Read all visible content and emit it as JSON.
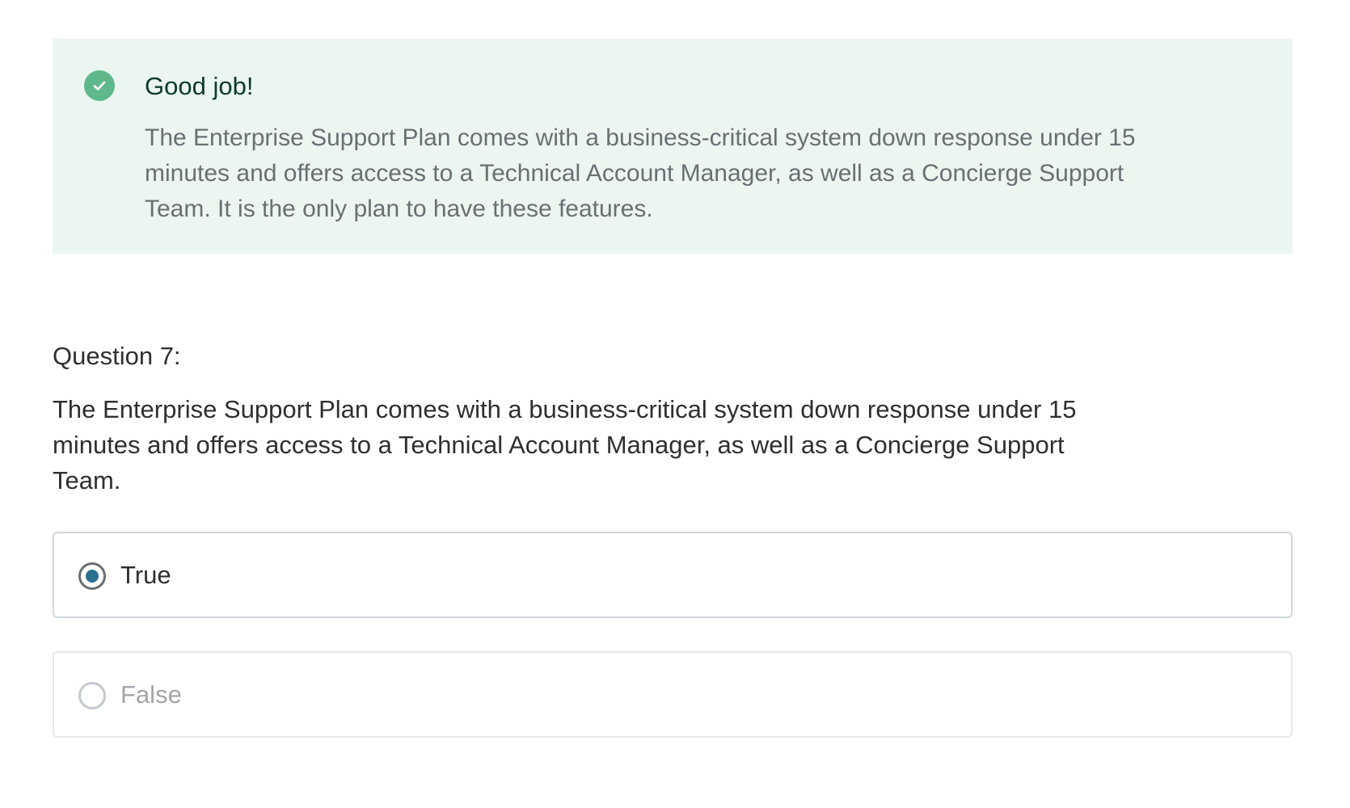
{
  "feedback": {
    "status_icon": "check-circle-icon",
    "status_color": "#5fb88c",
    "title": "Good job!",
    "body": "The Enterprise Support Plan comes with a business-critical system down response under 15 minutes and offers access to a Technical Account Manager, as well as a Concierge Support Team. It is the only plan to have these features."
  },
  "question": {
    "label": "Question 7:",
    "text": "The Enterprise Support Plan comes with a business-critical system down response under 15 minutes and offers access to a Technical Account Manager, as well as a Concierge Support Team."
  },
  "options": [
    {
      "label": "True",
      "selected": true
    },
    {
      "label": "False",
      "selected": false
    }
  ],
  "colors": {
    "feedback_background": "#ecf6f1",
    "selected_radio": "#2c6f8e"
  }
}
